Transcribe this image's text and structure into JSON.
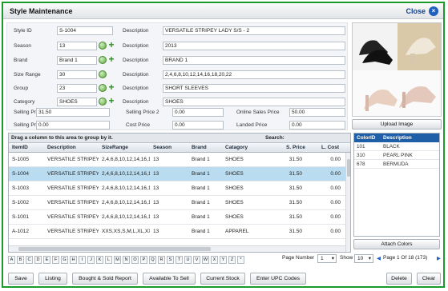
{
  "window": {
    "title": "Style Maintenance",
    "close_label": "Close",
    "close_glyph": "×"
  },
  "form": {
    "style_id_label": "Style ID",
    "style_id": "S-1004",
    "description_label": "Description",
    "style_desc": "VERSATILE STRIPEY LADY S/S - 2",
    "season_label": "Season",
    "season": "13",
    "season_desc": "2013",
    "brand_label": "Brand",
    "brand": "Brand 1",
    "brand_desc": "BRAND 1",
    "size_range_label": "Size Range",
    "size_range": "30",
    "size_range_desc": "2,4,6,8,10,12,14,16,18,20,22",
    "group_label": "Group",
    "group": "23",
    "group_desc": "SHORT SLEEVES",
    "category_label": "Category",
    "category": "SHOES",
    "category_desc": "SHOES",
    "sp1_label": "Selling Price 1",
    "sp1": "31.50",
    "sp2_label": "Selling Price 2",
    "sp2": "0.00",
    "osp_label": "Online Sales Price",
    "osp": "50.00",
    "sp3_label": "Selling Price 3",
    "sp3": "0.00",
    "cost_label": "Cost Price",
    "cost": "0.00",
    "landed_label": "Landed Price",
    "landed": "0.00"
  },
  "image_panel": {
    "upload_label": "Upload Image",
    "attach_label": "Attach Colors"
  },
  "grid": {
    "group_hint": "Drag a column to this area to group by it.",
    "search_label": "Search:",
    "columns": [
      "ItemID",
      "Description",
      "SizeRange",
      "Season",
      "Brand",
      "Catagory",
      "S. Price",
      "L. Cost"
    ],
    "rows": [
      [
        "S-1005",
        "VERSATILE STRIPEY LADY S/S",
        "2,4,6,8,10,12,14,16,18",
        "13",
        "Brand 1",
        "SHOES",
        "31.50",
        "0.00"
      ],
      [
        "S-1004",
        "VERSATILE STRIPEY LADY S/S",
        "2,4,6,8,10,12,14,16,18",
        "13",
        "Brand 1",
        "SHOES",
        "31.50",
        "0.00"
      ],
      [
        "S-1003",
        "VERSATILE STRIPEY LADY S/S",
        "2,4,6,8,10,12,14,16,18",
        "13",
        "Brand 1",
        "SHOES",
        "31.50",
        "0.00"
      ],
      [
        "S-1002",
        "VERSATILE STRIPEY LADY S/S",
        "2,4,6,8,10,12,14,16,18",
        "13",
        "Brand 1",
        "SHOES",
        "31.50",
        "0.00"
      ],
      [
        "S-1001",
        "VERSATILE STRIPEY LADY S/S",
        "2,4,6,8,10,12,14,16,18",
        "13",
        "Brand 1",
        "SHOES",
        "31.50",
        "0.00"
      ],
      [
        "A-1012",
        "VERSATILE STRIPEY LADY S/S",
        "XXS,XS,S,M,L,XL,XXL",
        "13",
        "Brand 1",
        "APPAREL",
        "31.50",
        "0.00"
      ]
    ]
  },
  "colors": {
    "columns": [
      "ColorID",
      "Description"
    ],
    "rows": [
      [
        "101",
        "BLACK"
      ],
      [
        "310",
        "PEARL PINK"
      ],
      [
        "678",
        "BERMUDA"
      ]
    ]
  },
  "alphabet": [
    "A",
    "B",
    "C",
    "D",
    "E",
    "F",
    "G",
    "H",
    "I",
    "J",
    "K",
    "L",
    "M",
    "N",
    "O",
    "P",
    "Q",
    "R",
    "S",
    "T",
    "U",
    "V",
    "W",
    "X",
    "Y",
    "Z",
    "*"
  ],
  "pager": {
    "page_number_label": "Page Number",
    "page_number": "1",
    "show_label": "Show",
    "show": "10",
    "info": "Page 1 Of 18 (173)"
  },
  "buttons": {
    "save": "Save",
    "listing": "Listing",
    "bought_sold": "Bought & Sold Report",
    "available": "Available To Sell",
    "current_stock": "Current Stock",
    "upc": "Enter UPC Codes",
    "delete": "Delete",
    "clear": "Clear"
  },
  "accent_colors": {
    "border": "#1a9a2a",
    "selected_row": "#b9dcf0",
    "color_header": "#1f5fa8"
  }
}
